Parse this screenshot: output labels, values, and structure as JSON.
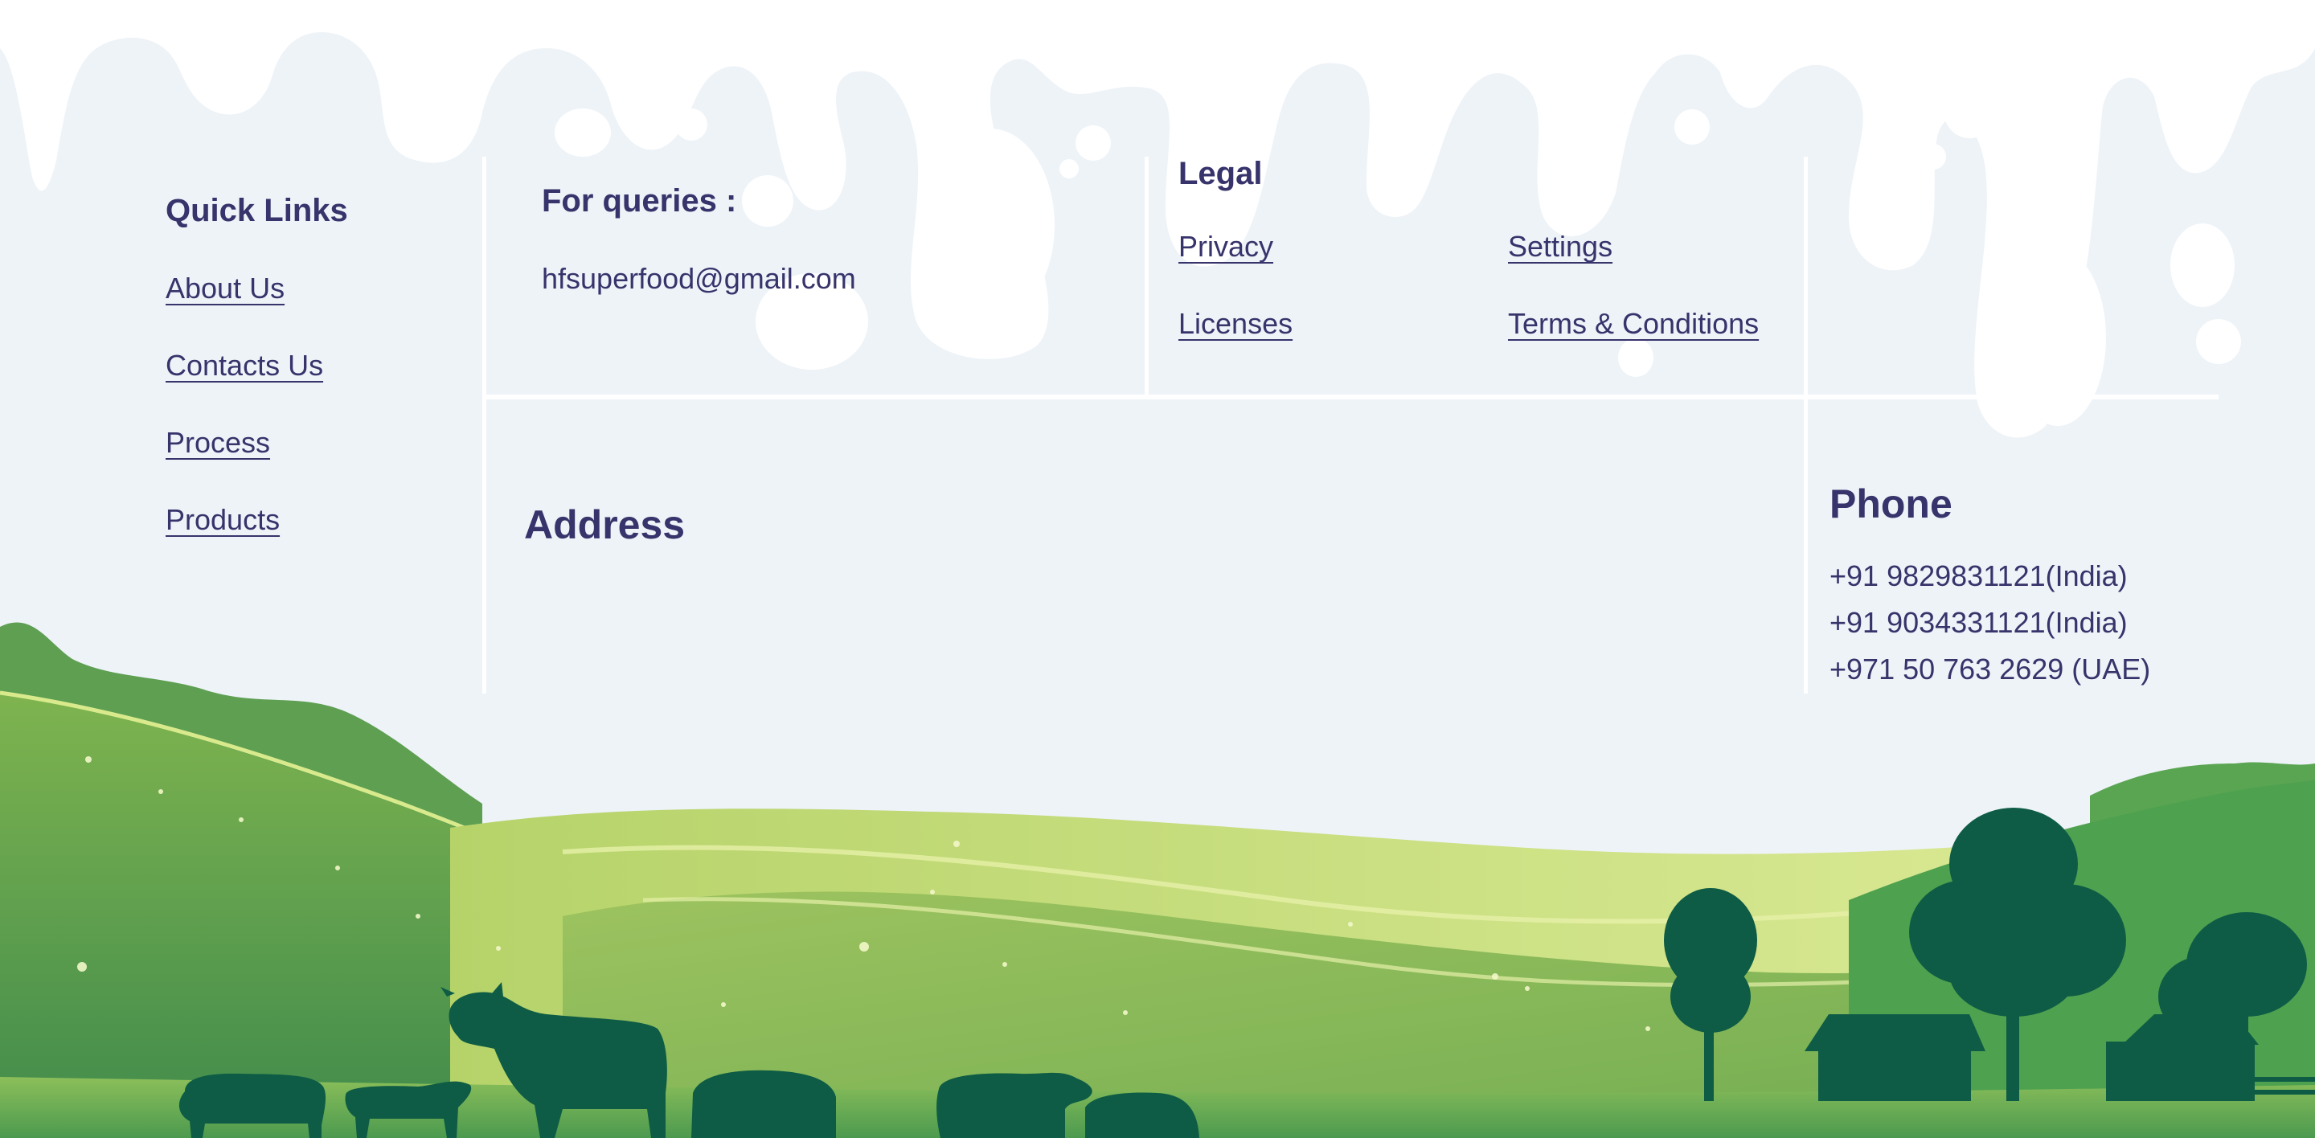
{
  "colors": {
    "background": "#eef3f8",
    "milk": "#ffffff",
    "text": "#37336b",
    "hill_dark": "#3f8a4c",
    "hill_light": "#c6dd7a",
    "silhouette": "#0e5c45"
  },
  "quick_links": {
    "title": "Quick Links",
    "items": [
      "About Us",
      "Contacts Us",
      "Process",
      "Products"
    ]
  },
  "queries": {
    "title": "For queries :",
    "email": "hfsuperfood@gmail.com"
  },
  "legal": {
    "title": "Legal",
    "items": [
      "Privacy",
      "Settings",
      "Licenses",
      "Terms & Conditions"
    ]
  },
  "address": {
    "title": "Address"
  },
  "phone": {
    "title": "Phone",
    "numbers": [
      "+91 9829831121(India)",
      "+91 9034331121(India)",
      "+971 50 763 2629 (UAE)"
    ]
  }
}
